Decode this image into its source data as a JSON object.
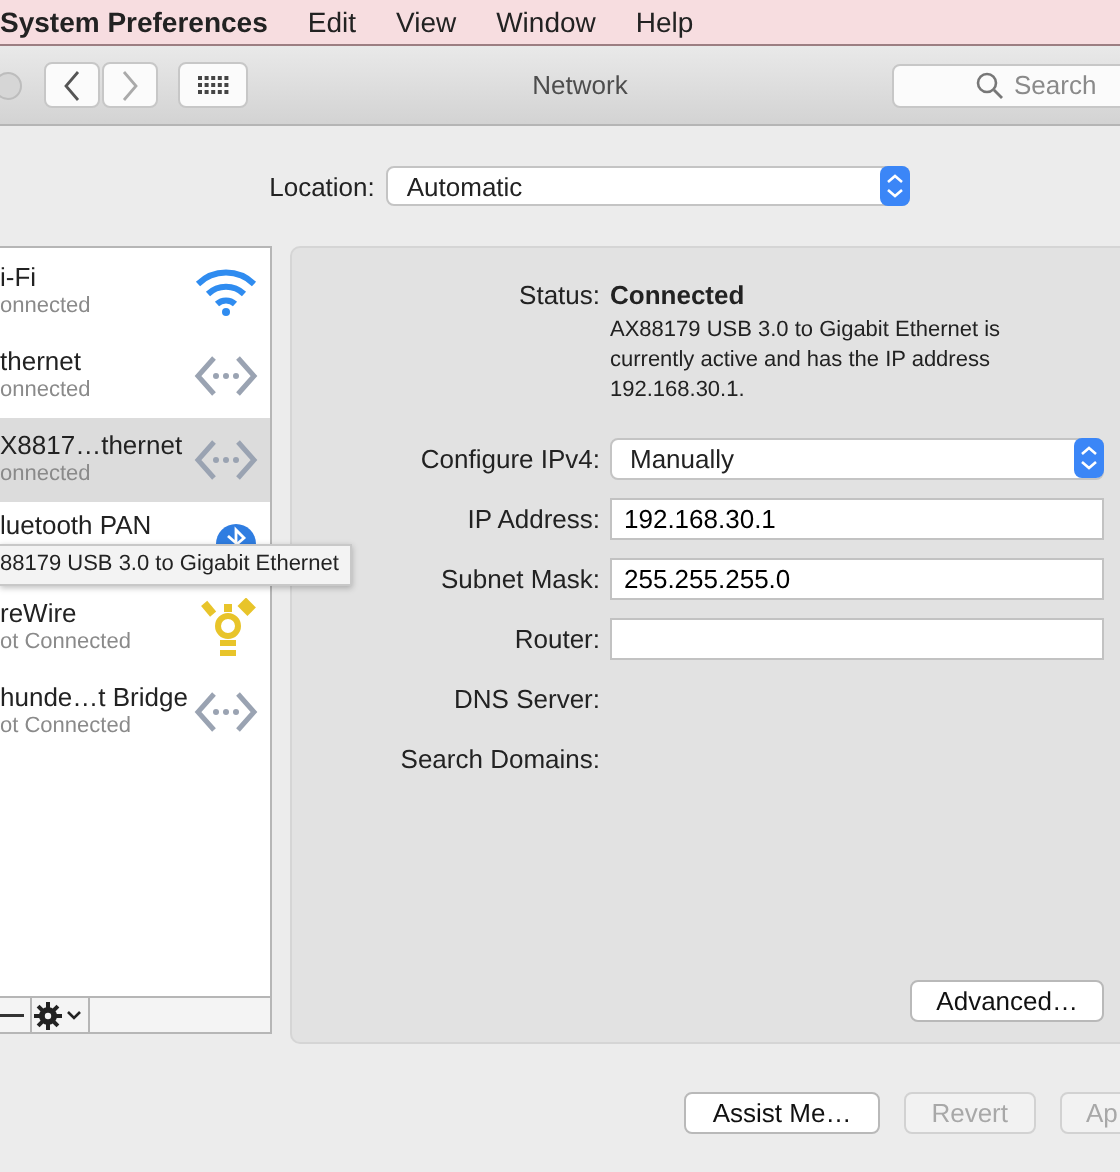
{
  "menu_bar": {
    "app": "System Preferences",
    "items": [
      "Edit",
      "View",
      "Window",
      "Help"
    ]
  },
  "toolbar": {
    "title": "Network",
    "search": {
      "placeholder": "Search"
    }
  },
  "location": {
    "label": "Location:",
    "value": "Automatic"
  },
  "services": [
    {
      "name": "i-Fi",
      "status": "onnected",
      "kind": "wifi",
      "selected": false
    },
    {
      "name": "thernet",
      "status": "onnected",
      "kind": "ethernet",
      "selected": false
    },
    {
      "name": "X8817…thernet",
      "status": "onnected",
      "kind": "ethernet",
      "selected": true
    },
    {
      "name": "luetooth PAN",
      "kind": "bluetooth",
      "selected": false
    },
    {
      "name": "reWire",
      "status": "ot Connected",
      "kind": "firewire",
      "selected": false
    },
    {
      "name": "hunde…t Bridge",
      "status": "ot Connected",
      "kind": "ethernet",
      "selected": false
    }
  ],
  "tooltip": "88179 USB 3.0 to Gigabit Ethernet",
  "details": {
    "status_label": "Status:",
    "status": "Connected",
    "description": "AX88179 USB 3.0 to Gigabit Ethernet is currently active and has the IP address 192.168.30.1.",
    "fields": [
      {
        "label": "Configure IPv4:",
        "kind": "select",
        "value": "Manually"
      },
      {
        "label": "IP Address:",
        "kind": "text",
        "value": "192.168.30.1"
      },
      {
        "label": "Subnet Mask:",
        "kind": "text",
        "value": "255.255.255.0"
      },
      {
        "label": "Router:",
        "kind": "text"
      },
      {
        "label": "DNS Server:",
        "kind": "static"
      },
      {
        "label": "Search Domains:",
        "kind": "static"
      }
    ],
    "advanced": "Advanced…"
  },
  "buttons": [
    {
      "label": "Assist Me…",
      "disabled": false
    },
    {
      "label": "Revert",
      "disabled": true
    },
    {
      "label": "Ap",
      "disabled": true
    }
  ]
}
